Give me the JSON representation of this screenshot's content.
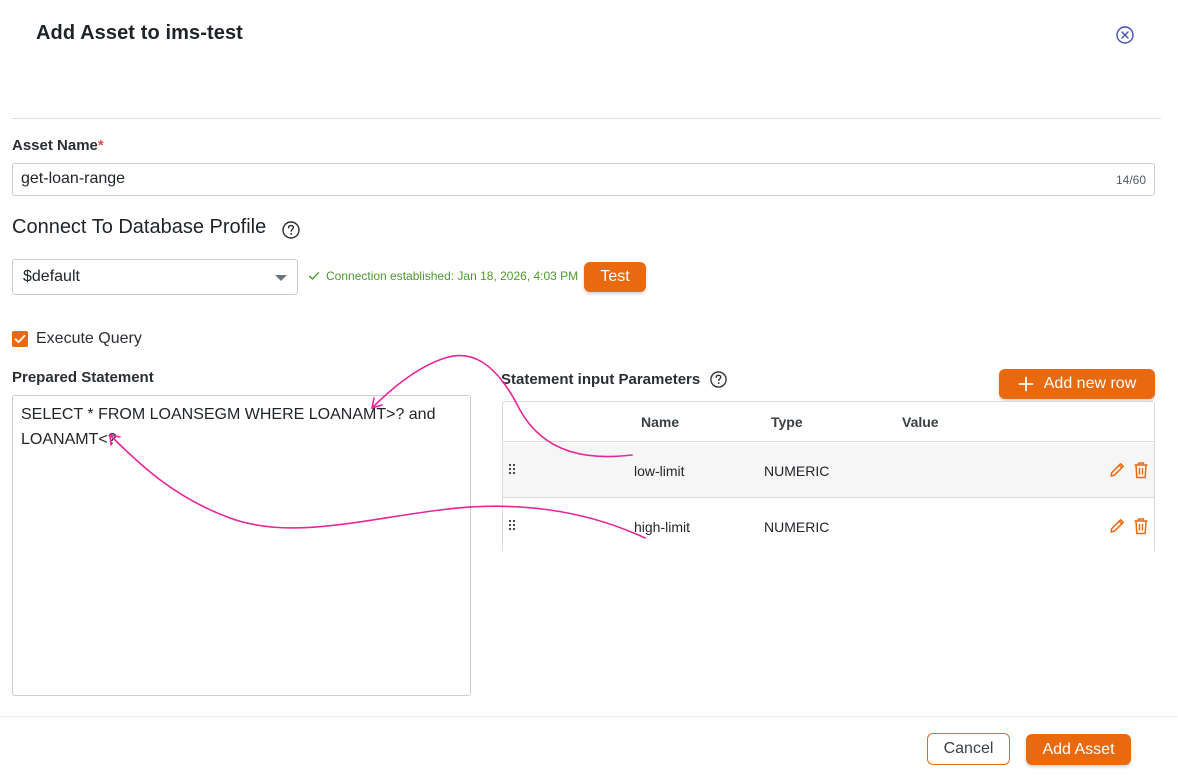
{
  "dialog": {
    "title": "Add Asset to ims-test"
  },
  "asset_name": {
    "label": "Asset Name",
    "required_mark": "*",
    "value": "get-loan-range",
    "char_count": "14/60"
  },
  "db_profile": {
    "title": "Connect To Database Profile",
    "selected": "$default",
    "status": "Connection established: Jan 18, 2026, 4:03 PM",
    "test_label": "Test"
  },
  "execute_query": {
    "label": "Execute Query",
    "checked": true
  },
  "prepared_statement": {
    "label": "Prepared Statement",
    "value": "SELECT * FROM LOANSEGM WHERE LOANAMT>? and\nLOANAMT<?"
  },
  "params": {
    "title": "Statement input Parameters",
    "add_row_label": "Add new row",
    "columns": [
      "Name",
      "Type",
      "Value"
    ],
    "rows": [
      {
        "name": "low-limit",
        "type": "NUMERIC",
        "value": ""
      },
      {
        "name": "high-limit",
        "type": "NUMERIC",
        "value": ""
      }
    ]
  },
  "footer": {
    "cancel_label": "Cancel",
    "add_asset_label": "Add Asset"
  },
  "colors": {
    "accent": "#e8690e",
    "success": "#4c9a2a",
    "annotation": "#e8259a",
    "close_icon": "#3f51b5"
  },
  "icons": [
    "close-circle-icon",
    "help-circle-icon",
    "check-icon",
    "caret-down-icon",
    "checkbox-check-icon",
    "plus-icon",
    "drag-handle-icon",
    "edit-pencil-icon",
    "trash-icon"
  ]
}
